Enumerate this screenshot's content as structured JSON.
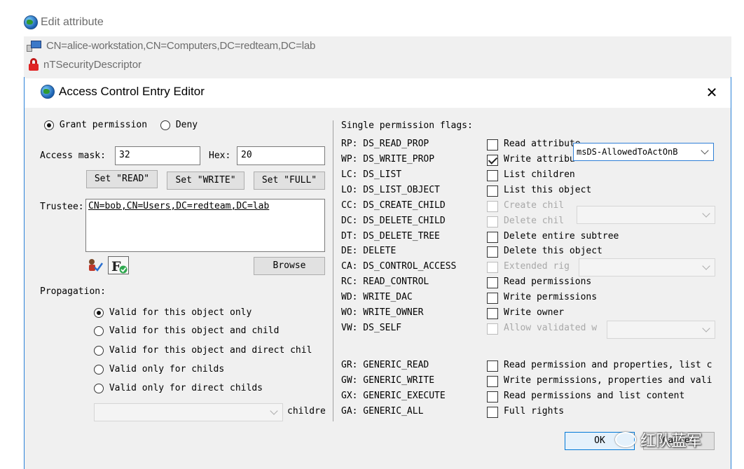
{
  "outer": {
    "title": "Edit attribute",
    "object_dn": "CN=alice-workstation,CN=Computers,DC=redteam,DC=lab",
    "attribute_name": "nTSecurityDescriptor"
  },
  "dialog": {
    "title": "Access Control Entry Editor",
    "close_glyph": "✕",
    "grant_label": "Grant permission",
    "deny_label": "Deny",
    "access_mask_label": "Access mask:",
    "access_mask_value": "32",
    "hex_label": "Hex:",
    "hex_value": "20",
    "set_read": "Set \"READ\"",
    "set_write": "Set \"WRITE\"",
    "set_full": "Set \"FULL\"",
    "trustee_label": "Trustee:",
    "trustee_value": "CN=bob,CN=Users,DC=redteam,DC=lab",
    "browse_label": "Browse",
    "propagation_label": "Propagation:",
    "propagation_options": [
      "Valid for this object only",
      "Valid for this object and child",
      "Valid for this object and direct chil",
      "Valid only for childs",
      "Valid only for direct childs"
    ],
    "children_suffix": "childre",
    "single_flags_label": "Single permission flags:",
    "flags": [
      {
        "code": "RP: DS_READ_PROP",
        "desc": "Read attribute",
        "checked": false,
        "enabled": true
      },
      {
        "code": "WP: DS_WRITE_PROP",
        "desc": "Write attribu",
        "checked": true,
        "enabled": true
      },
      {
        "code": "LC: DS_LIST",
        "desc": "List children",
        "checked": false,
        "enabled": true
      },
      {
        "code": "LO: DS_LIST_OBJECT",
        "desc": "List this object",
        "checked": false,
        "enabled": true
      },
      {
        "code": "CC: DS_CREATE_CHILD",
        "desc": "Create chil",
        "checked": false,
        "enabled": false
      },
      {
        "code": "DC: DS_DELETE_CHILD",
        "desc": "Delete chil",
        "checked": false,
        "enabled": false
      },
      {
        "code": "DT: DS_DELETE_TREE",
        "desc": "Delete entire subtree",
        "checked": false,
        "enabled": true
      },
      {
        "code": "DE: DELETE",
        "desc": "Delete this object",
        "checked": false,
        "enabled": true
      },
      {
        "code": "CA: DS_CONTROL_ACCESS",
        "desc": "Extended rig",
        "checked": false,
        "enabled": false
      },
      {
        "code": "RC: READ_CONTROL",
        "desc": "Read permissions",
        "checked": false,
        "enabled": true
      },
      {
        "code": "WD: WRITE_DAC",
        "desc": "Write permissions",
        "checked": false,
        "enabled": true
      },
      {
        "code": "WO: WRITE_OWNER",
        "desc": "Write owner",
        "checked": false,
        "enabled": true
      },
      {
        "code": "VW: DS_SELF",
        "desc": "Allow validated w",
        "checked": false,
        "enabled": false
      }
    ],
    "generic_flags": [
      {
        "code": "GR: GENERIC_READ",
        "desc": "Read permission and properties, list c",
        "checked": false
      },
      {
        "code": "GW: GENERIC_WRITE",
        "desc": "Write permissions, properties and vali",
        "checked": false
      },
      {
        "code": "GX: GENERIC_EXECUTE",
        "desc": "Read permissions and list content",
        "checked": false
      },
      {
        "code": "GA: GENERIC_ALL",
        "desc": "Full rights",
        "checked": false
      }
    ],
    "attribute_dropdown_value": "msDS-AllowedToActOnB",
    "ok_label": "OK",
    "cancel_label": "Cancel"
  },
  "watermark": "红队蓝军"
}
